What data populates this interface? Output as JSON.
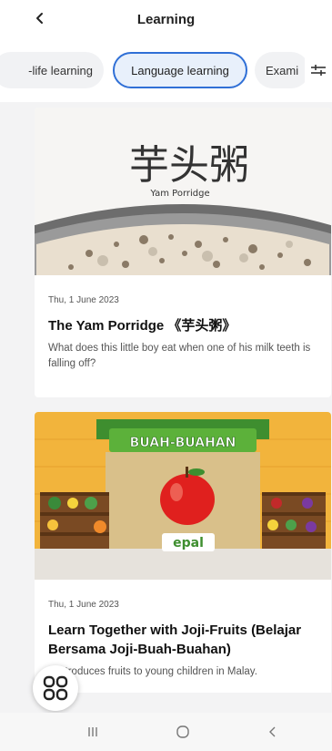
{
  "header": {
    "title": "Learning",
    "back_icon": "chevron-left-icon"
  },
  "tabs": [
    {
      "label": "-life learning",
      "active": false
    },
    {
      "label": "Language learning",
      "active": true
    },
    {
      "label": "Exami",
      "active": false
    }
  ],
  "filter_icon": "sliders-icon",
  "cards": [
    {
      "image_text_main": "芋头粥",
      "image_text_sub": "Yam Porridge",
      "date": "Thu, 1 June 2023",
      "title": "The Yam Porridge 《芋头粥》",
      "description": "What does this little boy eat when one of his milk teeth is falling off?"
    },
    {
      "image_banner": "BUAH-BUAHAN",
      "image_sign": "epal",
      "date": "Thu, 1 June 2023",
      "title": "Learn Together with Joji-Fruits (Belajar Bersama Joji-Buah-Buahan)",
      "description": "It introduces fruits to young children in Malay."
    }
  ],
  "fab_icon": "grid-apps-icon",
  "colors": {
    "accent": "#2f6fd6",
    "active_tab_bg": "#e8f0fb",
    "background": "#f3f3f4"
  }
}
